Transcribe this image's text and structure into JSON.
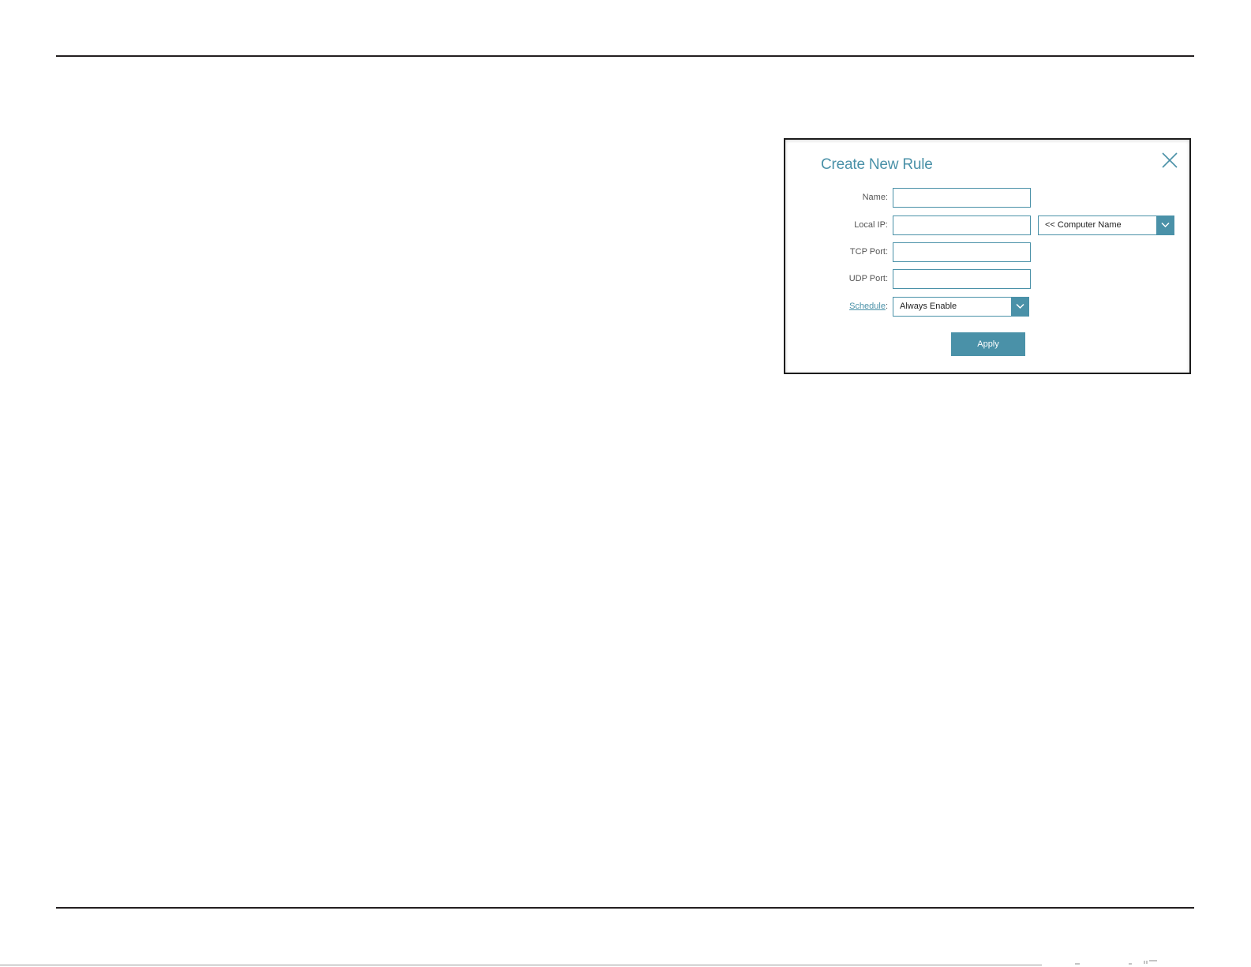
{
  "dialog": {
    "title": "Create New Rule",
    "close_icon": "close-icon",
    "fields": {
      "name": {
        "label": "Name:",
        "value": "",
        "placeholder": ""
      },
      "local_ip": {
        "label": "Local IP:",
        "value": "",
        "placeholder": ""
      },
      "tcp_port": {
        "label": "TCP Port:",
        "value": "",
        "placeholder": ""
      },
      "udp_port": {
        "label": "UDP Port:",
        "value": "",
        "placeholder": ""
      }
    },
    "computer_name_select": {
      "selected": "<< Computer Name",
      "icon": "chevron-down-icon"
    },
    "schedule": {
      "label_link": "Schedule",
      "label_suffix": ":",
      "selected": "Always Enable",
      "icon": "chevron-down-icon"
    },
    "apply_label": "Apply"
  },
  "colors": {
    "accent": "#4a91a8",
    "rule_line": "#231f20",
    "dialog_border": "#1c1c1c"
  }
}
